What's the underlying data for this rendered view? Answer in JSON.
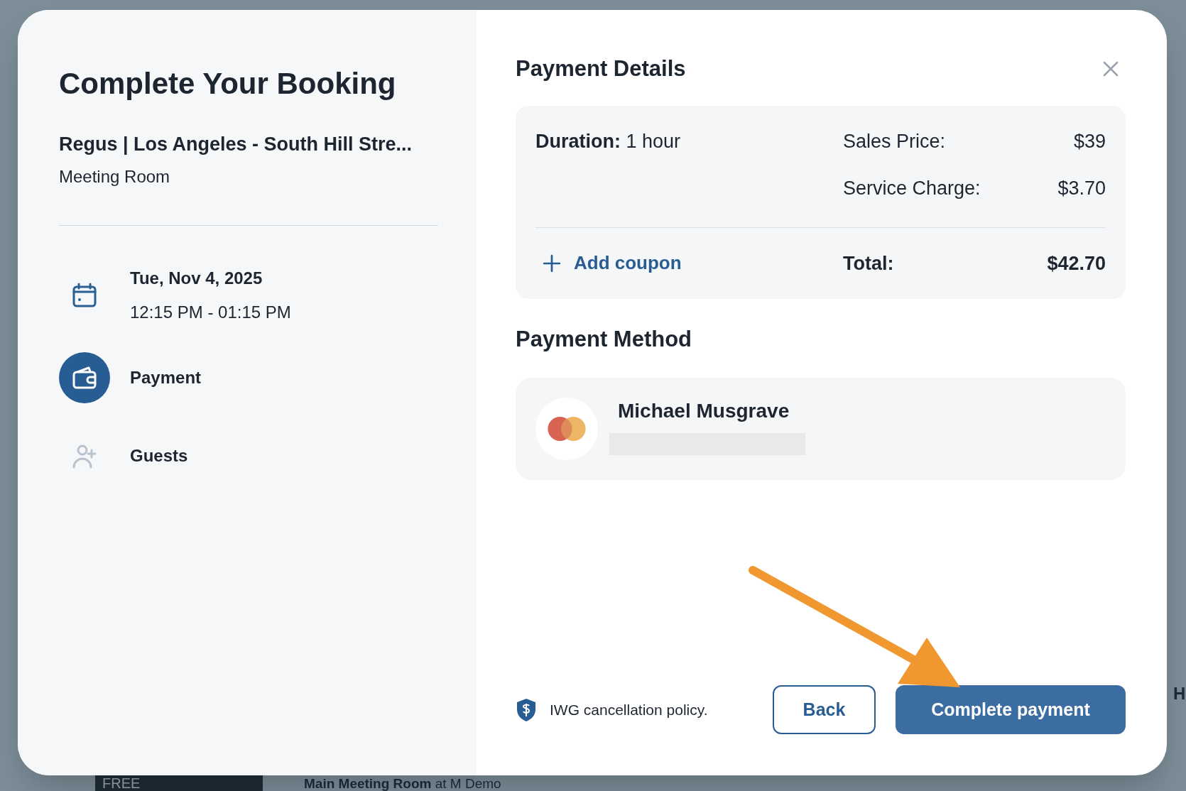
{
  "background": {
    "badge": "FREE",
    "listing_title": "Main Meeting Room",
    "listing_location": "at M Demo",
    "side_letter": "H"
  },
  "booking": {
    "title": "Complete Your Booking",
    "venue": "Regus | Los Angeles - South Hill Stre...",
    "room_type": "Meeting Room",
    "steps": [
      {
        "kind": "date",
        "label": "Tue, Nov 4, 2025",
        "detail": "12:15 PM - 01:15 PM",
        "active": false
      },
      {
        "kind": "payment",
        "label": "Payment",
        "active": true
      },
      {
        "kind": "guests",
        "label": "Guests",
        "active": false
      }
    ]
  },
  "payment_details": {
    "title": "Payment Details",
    "duration_label": "Duration:",
    "duration_value": "1 hour",
    "lines": [
      {
        "label": "Sales Price:",
        "value": "$39"
      },
      {
        "label": "Service Charge:",
        "value": "$3.70"
      }
    ],
    "coupon_link": "Add coupon",
    "total_label": "Total:",
    "total_value": "$42.70"
  },
  "payment_method": {
    "title": "Payment Method",
    "cardholder": "Michael Musgrave"
  },
  "footer": {
    "policy": "IWG cancellation policy.",
    "back_button": "Back",
    "primary_button": "Complete payment"
  }
}
